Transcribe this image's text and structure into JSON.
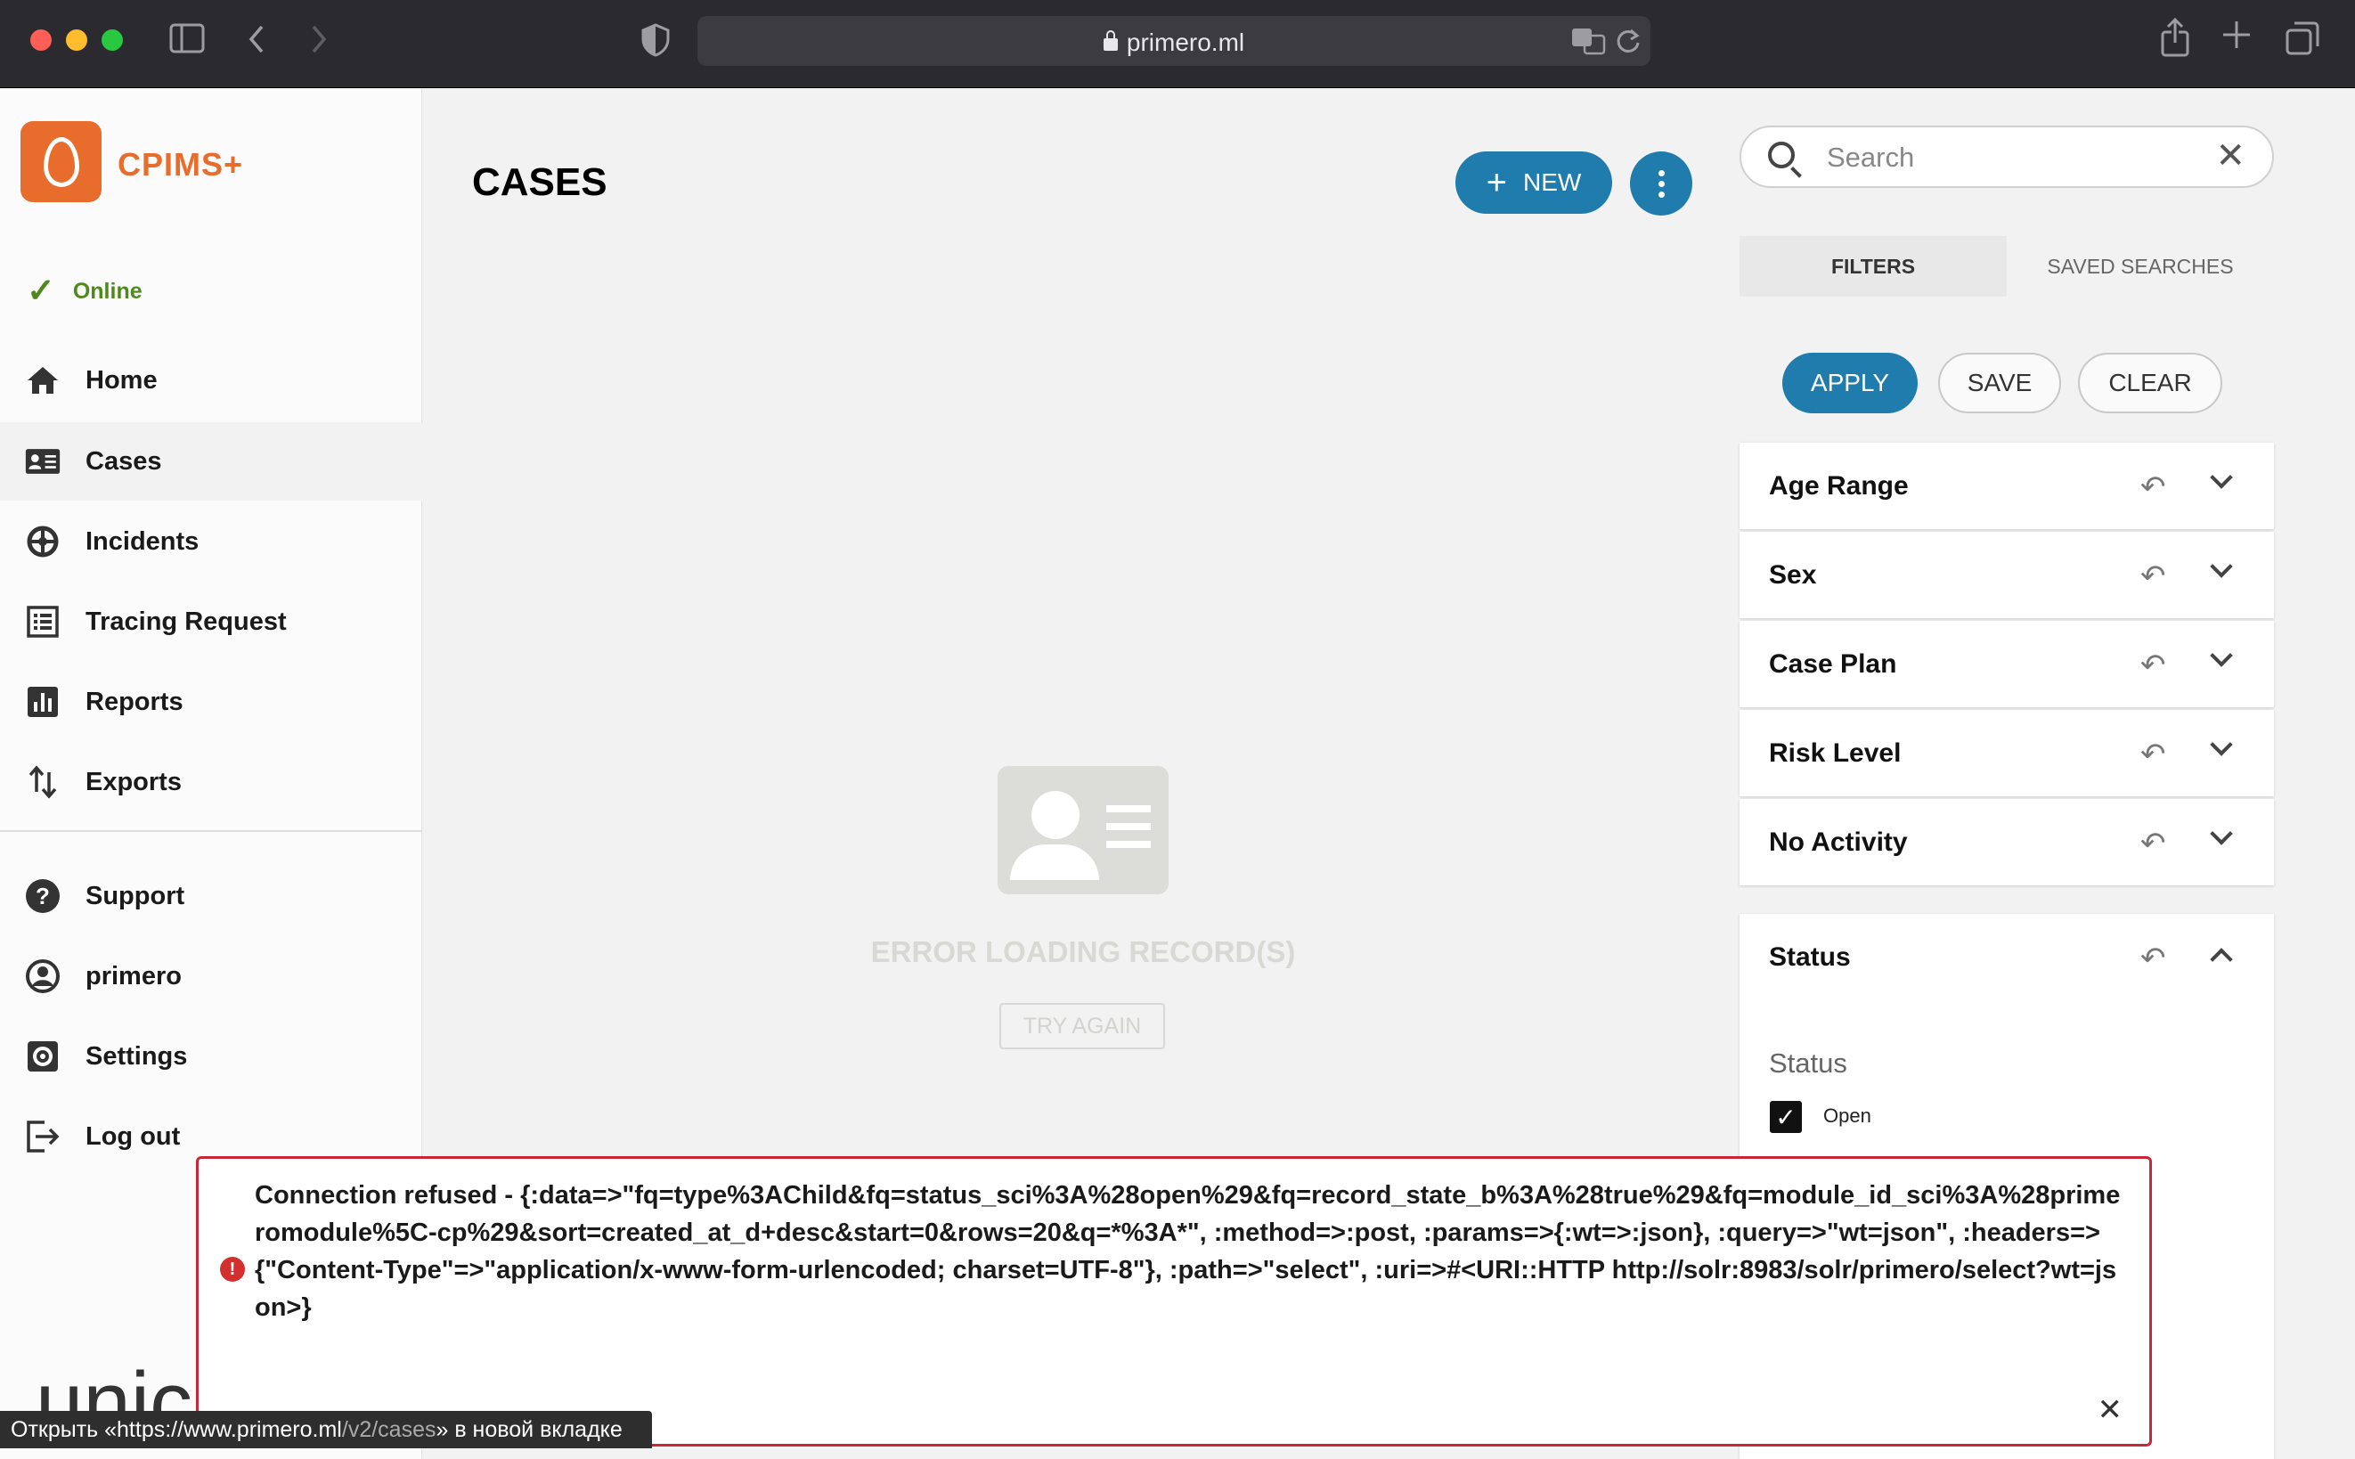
{
  "browser": {
    "url": "primero.ml"
  },
  "sidebar": {
    "brand": "CPIMS+",
    "online_label": "Online",
    "items": [
      {
        "label": "Home",
        "icon": "home-icon"
      },
      {
        "label": "Cases",
        "icon": "id-card-icon"
      },
      {
        "label": "Incidents",
        "icon": "incidents-icon"
      },
      {
        "label": "Tracing Request",
        "icon": "list-icon"
      },
      {
        "label": "Reports",
        "icon": "bar-chart-icon"
      },
      {
        "label": "Exports",
        "icon": "swap-vertical-icon"
      }
    ],
    "footer_items": [
      {
        "label": "Support",
        "icon": "help-icon"
      },
      {
        "label": "primero",
        "icon": "account-icon"
      },
      {
        "label": "Settings",
        "icon": "gear-icon"
      },
      {
        "label": "Log out",
        "icon": "logout-icon"
      }
    ],
    "partner_logo_text": "unic"
  },
  "main": {
    "title": "CASES",
    "new_button": "NEW",
    "empty_state": {
      "message": "ERROR LOADING RECORD(S)",
      "retry": "TRY AGAIN"
    }
  },
  "panel": {
    "search_placeholder": "Search",
    "tabs": [
      "FILTERS",
      "SAVED SEARCHES"
    ],
    "actions": {
      "apply": "APPLY",
      "save": "SAVE",
      "clear": "CLEAR"
    },
    "filters": [
      "Age Range",
      "Sex",
      "Case Plan",
      "Risk Level",
      "No Activity"
    ],
    "status": {
      "title": "Status",
      "subtitle": "Status",
      "option": "Open",
      "checked": true
    }
  },
  "toast": {
    "message": "Connection refused - {:data=>\"fq=type%3AChild&fq=status_sci%3A%28open%29&fq=record_state_b%3A%28true%29&fq=module_id_sci%3A%28primeromodule%5C-cp%29&sort=created_at_d+desc&start=0&rows=20&q=*%3A*\", :method=>:post, :params=>{:wt=>:json}, :query=>\"wt=json\", :headers=>{\"Content-Type\"=>\"application/x-www-form-urlencoded; charset=UTF-8\"}, :path=>\"select\", :uri=>#<URI::HTTP http://solr:8983/solr/primero/select?wt=json>}"
  },
  "statusbar": {
    "prefix": "Открыть «https://www.primero.ml",
    "path": "/v2/cases",
    "suffix": "» в новой вкладке"
  },
  "colors": {
    "accent": "#1f7cad",
    "brand": "#e86d2c",
    "online": "#4e8a1b",
    "error": "#c62839"
  }
}
